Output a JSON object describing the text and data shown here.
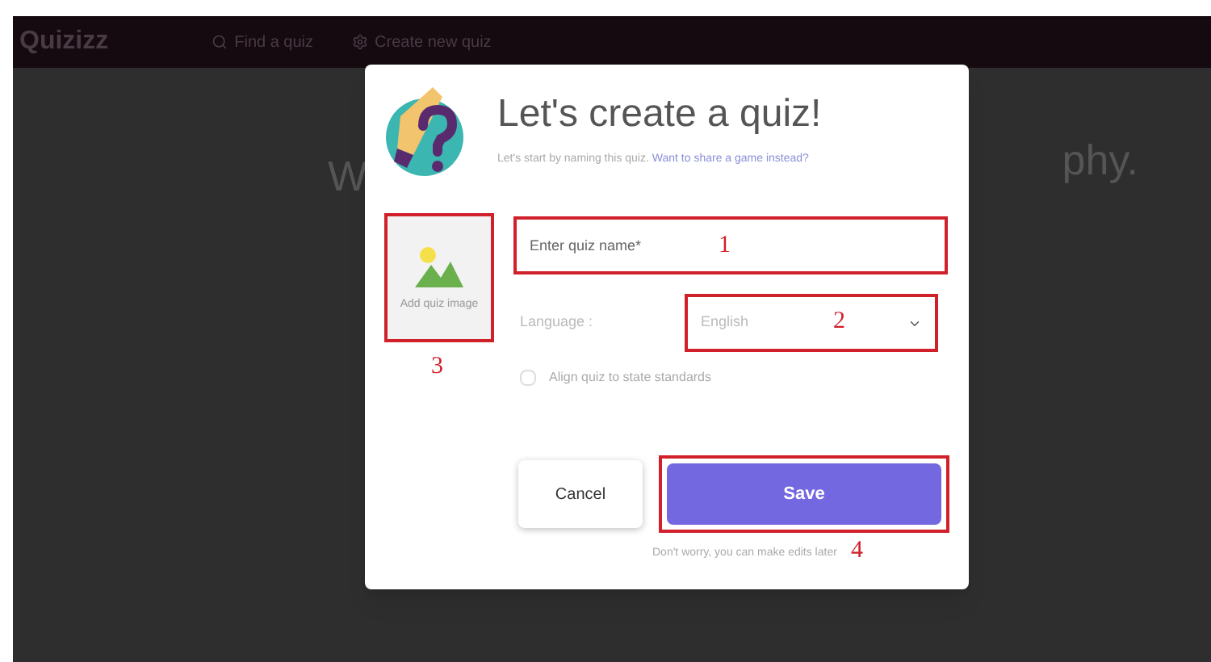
{
  "navbar": {
    "logo": "Quizizz",
    "links": [
      {
        "label": "Find a quiz"
      },
      {
        "label": "Create new quiz"
      }
    ]
  },
  "background": {
    "heading_left": "W",
    "heading_right": "phy."
  },
  "dialog": {
    "title": "Let's create a quiz!",
    "subtitle": "Let's start by naming this quiz.",
    "subtitle_link": "Want to share a game instead?",
    "image_upload": {
      "label": "Add quiz image",
      "annotation": "3"
    },
    "name_field": {
      "placeholder": "Enter quiz name*",
      "annotation": "1"
    },
    "language": {
      "label": "Language :",
      "value": "English",
      "annotation": "2"
    },
    "standards": {
      "label": "Align quiz to state standards",
      "checked": false
    },
    "cancel": "Cancel",
    "save": {
      "label": "Save",
      "annotation": "4"
    },
    "footnote": "Don't worry, you can make edits later"
  }
}
